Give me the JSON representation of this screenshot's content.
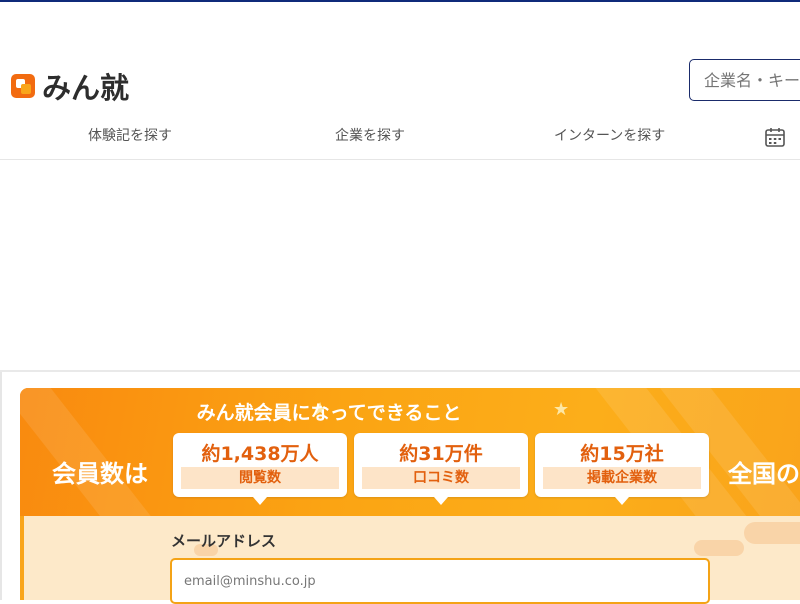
{
  "header": {
    "logo_text": "みん就",
    "search_placeholder": "企業名・キーワード"
  },
  "nav": {
    "items": [
      {
        "label": "体験記を探す"
      },
      {
        "label": "企業を探す"
      },
      {
        "label": "インターンを探す"
      }
    ],
    "calendar_icon": "calendar-icon"
  },
  "banner": {
    "title": "みん就会員になってできること",
    "left_text": "会員数は",
    "right_text": "全国の学生",
    "stats": [
      {
        "value": "約1,438万人",
        "label": "閲覧数"
      },
      {
        "value": "約31万件",
        "label": "口コミ数"
      },
      {
        "value": "約15万社",
        "label": "掲載企業数"
      }
    ],
    "colors": {
      "accent": "#f9a51a",
      "stat_text": "#e2600e"
    }
  },
  "signup": {
    "email_label": "メールアドレス",
    "email_placeholder": "email@minshu.co.jp"
  }
}
